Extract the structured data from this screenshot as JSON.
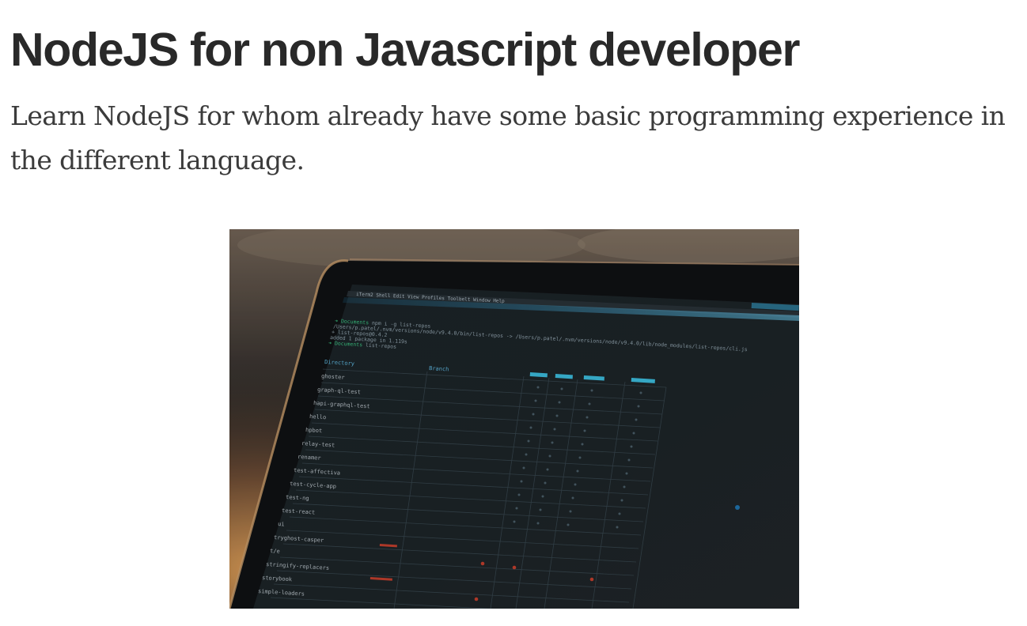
{
  "article": {
    "title": "NodeJS for non Javascript developer",
    "subtitle": "Learn NodeJS for whom already have some basic programming experience in the different language."
  },
  "hero_image": {
    "menu_items": [
      "iTerm2",
      "Shell",
      "Edit",
      "View",
      "Profiles",
      "Toolbelt",
      "Window",
      "Help"
    ],
    "terminal_lines": [
      "➜ Documents npm i -g list-repos",
      "/Users/p.patel/.nvm/versions/node/v9.4.0/bin/list-repos -> /Users/p.patel/.nvm/versions/node/v9.4.0/lib/node_modules/list-repos/cli.js",
      "+ list-repos@0.4.2",
      "added 1 package in 1.119s",
      "➜ Documents list-repos"
    ],
    "table_headers": [
      "Directory",
      "Branch"
    ],
    "directories": [
      "ghoster",
      "graph-ql-test",
      "hapi-graphql-test",
      "hello",
      "hpbot",
      "relay-test",
      "renamer",
      "test-affectiva",
      "test-cycle-app",
      "test-ng",
      "test-react",
      "ui",
      "tryghost-casper",
      "t/e",
      "stringify-replacers",
      "storybook",
      "simple-loaders"
    ]
  }
}
